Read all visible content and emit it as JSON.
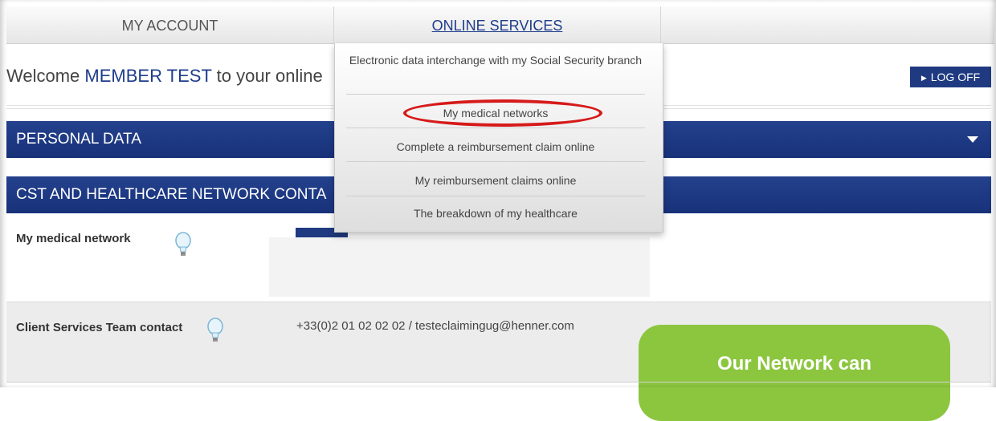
{
  "nav": {
    "my_account": "MY ACCOUNT",
    "online_services": "ONLINE SERVICES"
  },
  "welcome": {
    "prefix": "Welcome ",
    "member_name": "MEMBER TEST",
    "suffix": " to your online"
  },
  "logoff": {
    "label": "LOG OFF",
    "icon": "triangle-right-icon"
  },
  "sections": {
    "personal_data": "PERSONAL DATA",
    "cst_network": "CST AND HEALTHCARE NETWORK CONTA"
  },
  "rows": {
    "medical_network_label": "My medical network",
    "client_services_label": "Client Services Team contact",
    "client_services_value": "+33(0)2 01 02 02 02 / testeclaimingug@henner.com"
  },
  "dropdown": {
    "items": [
      "Electronic data interchange with my Social Security branch",
      "My medical networks",
      "Complete a reimbursement claim online",
      "My reimbursement claims online",
      "The breakdown of my healthcare"
    ],
    "highlighted_index": 1
  },
  "callout": {
    "text": "Our Network can"
  },
  "colors": {
    "brand_blue": "#1f3a80",
    "highlight_red": "#d61a1a",
    "callout_green": "#8cc63f"
  }
}
